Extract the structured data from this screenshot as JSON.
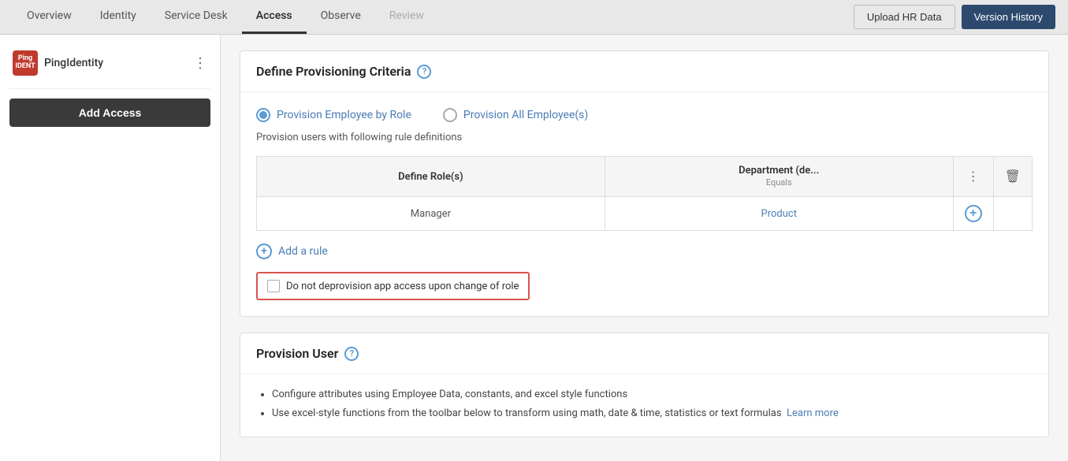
{
  "nav": {
    "tabs": [
      {
        "label": "Overview",
        "id": "overview",
        "active": false,
        "disabled": false
      },
      {
        "label": "Identity",
        "id": "identity",
        "active": false,
        "disabled": false
      },
      {
        "label": "Service Desk",
        "id": "service-desk",
        "active": false,
        "disabled": false
      },
      {
        "label": "Access",
        "id": "access",
        "active": true,
        "disabled": false
      },
      {
        "label": "Observe",
        "id": "observe",
        "active": false,
        "disabled": false
      },
      {
        "label": "Review",
        "id": "review",
        "active": false,
        "disabled": true
      }
    ],
    "upload_btn": "Upload HR Data",
    "version_btn": "Version History"
  },
  "sidebar": {
    "brand_name": "PingIdentity",
    "logo_text": "Ping\nIDENTITY",
    "add_access_btn": "Add Access",
    "menu_icon": "⋮"
  },
  "define_provisioning": {
    "title": "Define Provisioning Criteria",
    "help_icon": "?",
    "radio_option_1": "Provision Employee by Role",
    "radio_option_2": "Provision All Employee(s)",
    "subtitle": "Provision users with following rule definitions",
    "table": {
      "col1_header": "Define Role(s)",
      "col2_header": "Department (de...",
      "col2_subheader": "Equals",
      "col3_header": "⋮",
      "col4_header": "🗑",
      "row1_role": "Manager",
      "row1_dept": "Product"
    },
    "add_rule_label": "Add a rule",
    "checkbox_label": "Do not deprovision app access upon change of role"
  },
  "provision_user": {
    "title": "Provision User",
    "help_icon": "?",
    "bullets": [
      "Configure attributes using Employee Data, constants, and excel style functions",
      "Use excel-style functions from the toolbar below to transform using math, date & time, statistics or text formulas"
    ],
    "learn_more": "Learn more"
  }
}
